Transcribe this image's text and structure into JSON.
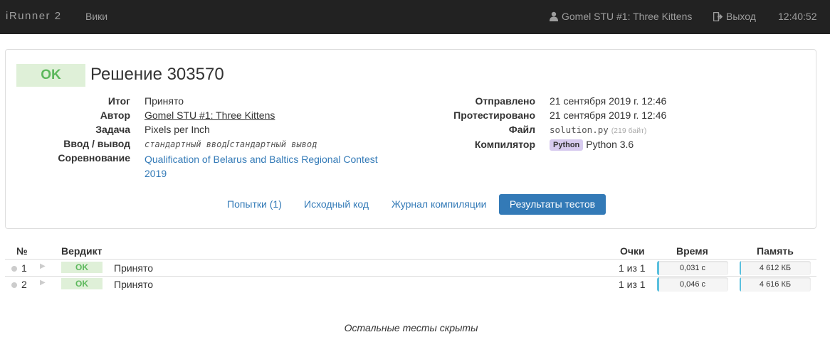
{
  "navbar": {
    "brand": "iRunner 2",
    "wiki": "Вики",
    "user": "Gomel STU #1: Three Kittens",
    "logout": "Выход",
    "clock": "12:40:52"
  },
  "solution": {
    "verdict_badge": "OK",
    "title": "Решение 303570",
    "left_fields": [
      {
        "label": "Итог",
        "value": "Принято"
      },
      {
        "label": "Автор",
        "value": "Gomel STU #1: Three Kittens"
      },
      {
        "label": "Задача",
        "value": "Pixels per Inch"
      },
      {
        "label": "Ввод / вывод",
        "value_in": "стандартный ввод",
        "sep": "/",
        "value_out": "стандартный вывод"
      },
      {
        "label": "Соревнование",
        "value": "Qualification of Belarus and Baltics Regional Contest 2019"
      }
    ],
    "right_fields": [
      {
        "label": "Отправлено",
        "value": "21 сентября 2019 г. 12:46"
      },
      {
        "label": "Протестировано",
        "value": "21 сентября 2019 г. 12:46"
      },
      {
        "label": "Файл",
        "value": "solution.py",
        "extra": "(219 байт)"
      },
      {
        "label": "Компилятор",
        "badge": "Python",
        "value": "Python 3.6"
      }
    ],
    "tabs": [
      {
        "label": "Попытки (1)"
      },
      {
        "label": "Исходный код"
      },
      {
        "label": "Журнал компиляции"
      },
      {
        "label": "Результаты тестов"
      }
    ]
  },
  "tests": {
    "headers": {
      "num": "№",
      "verdict": "Вердикт",
      "score": "Очки",
      "time": "Время",
      "memory": "Память"
    },
    "rows": [
      {
        "num": "1",
        "badge": "OK",
        "verdict": "Принято",
        "score": "1 из 1",
        "time": "0,031 с",
        "time_fraction": 0.03,
        "memory": "4 612 КБ",
        "memory_fraction": 0.02
      },
      {
        "num": "2",
        "badge": "OK",
        "verdict": "Принято",
        "score": "1 из 1",
        "time": "0,046 с",
        "time_fraction": 0.03,
        "memory": "4 616 КБ",
        "memory_fraction": 0.02
      }
    ],
    "hidden_note": "Остальные тесты скрыты"
  },
  "colors": {
    "navbar_bg": "#222222",
    "ok_green": "#5cb85c",
    "ok_bg": "#dff0d8",
    "link": "#337ab7",
    "python_badge": "#d7cbef"
  }
}
